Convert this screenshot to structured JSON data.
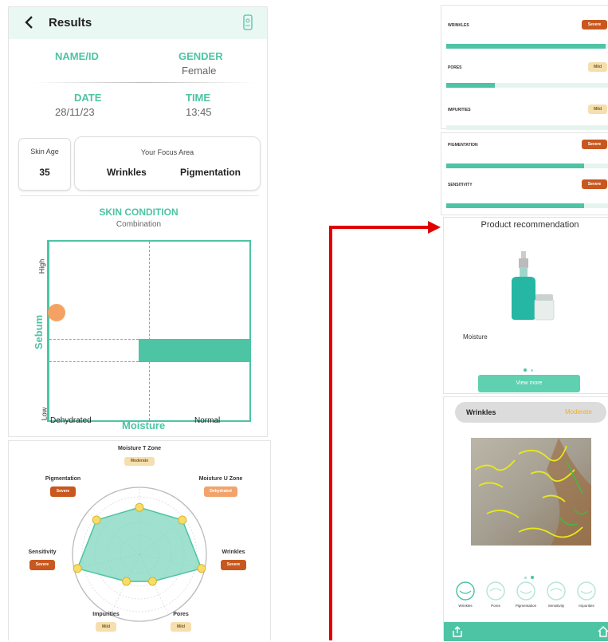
{
  "left": {
    "header": {
      "title": "Results"
    },
    "info": {
      "name_label": "NAME/ID",
      "name_value": "",
      "gender_label": "GENDER",
      "gender_value": "Female",
      "date_label": "DATE",
      "date_value": "28/11/23",
      "time_label": "TIME",
      "time_value": "13:45"
    },
    "skin_age": {
      "label": "Skin Age",
      "value": "35"
    },
    "focus": {
      "label": "Your Focus Area",
      "items": [
        "Wrinkles",
        "Pigmentation"
      ]
    },
    "condition": {
      "title": "SKIN CONDITION",
      "value": "Combination",
      "y_axis": "Sebum",
      "y_high": "High",
      "y_low": "Low",
      "x_axis": "Moisture",
      "x_left": "Dehydrated",
      "x_right": "Normal"
    },
    "radar": {
      "labels": [
        {
          "name": "Moisture T Zone",
          "level": "Moderate",
          "value": 0.7
        },
        {
          "name": "Moisture U Zone",
          "level": "Dehydrated",
          "value": 0.82
        },
        {
          "name": "Wrinkles",
          "level": "Severe",
          "value": 0.95
        },
        {
          "name": "Pores",
          "level": "Mild",
          "value": 0.45
        },
        {
          "name": "Impurities",
          "level": "Mild",
          "value": 0.45
        },
        {
          "name": "Sensitivity",
          "level": "Severe",
          "value": 0.95
        },
        {
          "name": "Pigmentation",
          "level": "Severe",
          "value": 0.82
        }
      ]
    }
  },
  "right": {
    "metrics_a": [
      {
        "name": "WRINKLES",
        "level": "Severe",
        "value": 0.98
      },
      {
        "name": "PORES",
        "level": "Mild",
        "value": 0.3
      },
      {
        "name": "IMPURITIES",
        "level": "Mild",
        "value": 0.0
      }
    ],
    "metrics_b": [
      {
        "name": "PIGMENTATION",
        "level": "Severe",
        "value": 0.85
      },
      {
        "name": "SENSITIVITY",
        "level": "Severe",
        "value": 0.85
      }
    ],
    "product": {
      "title": "Product recommendation",
      "name": "Moisture",
      "view_more": "View more"
    },
    "analysis": {
      "label": "Wrinkles",
      "level": "Moderate"
    },
    "tabs": [
      "Wrinkles",
      "Pores",
      "Pigmentation",
      "Sensitivity",
      "Impurities"
    ]
  },
  "colors": {
    "teal": "#4dc4a4",
    "severe": "#c8581f",
    "mild": "#f6dfaf",
    "arrow": "#e10000"
  }
}
